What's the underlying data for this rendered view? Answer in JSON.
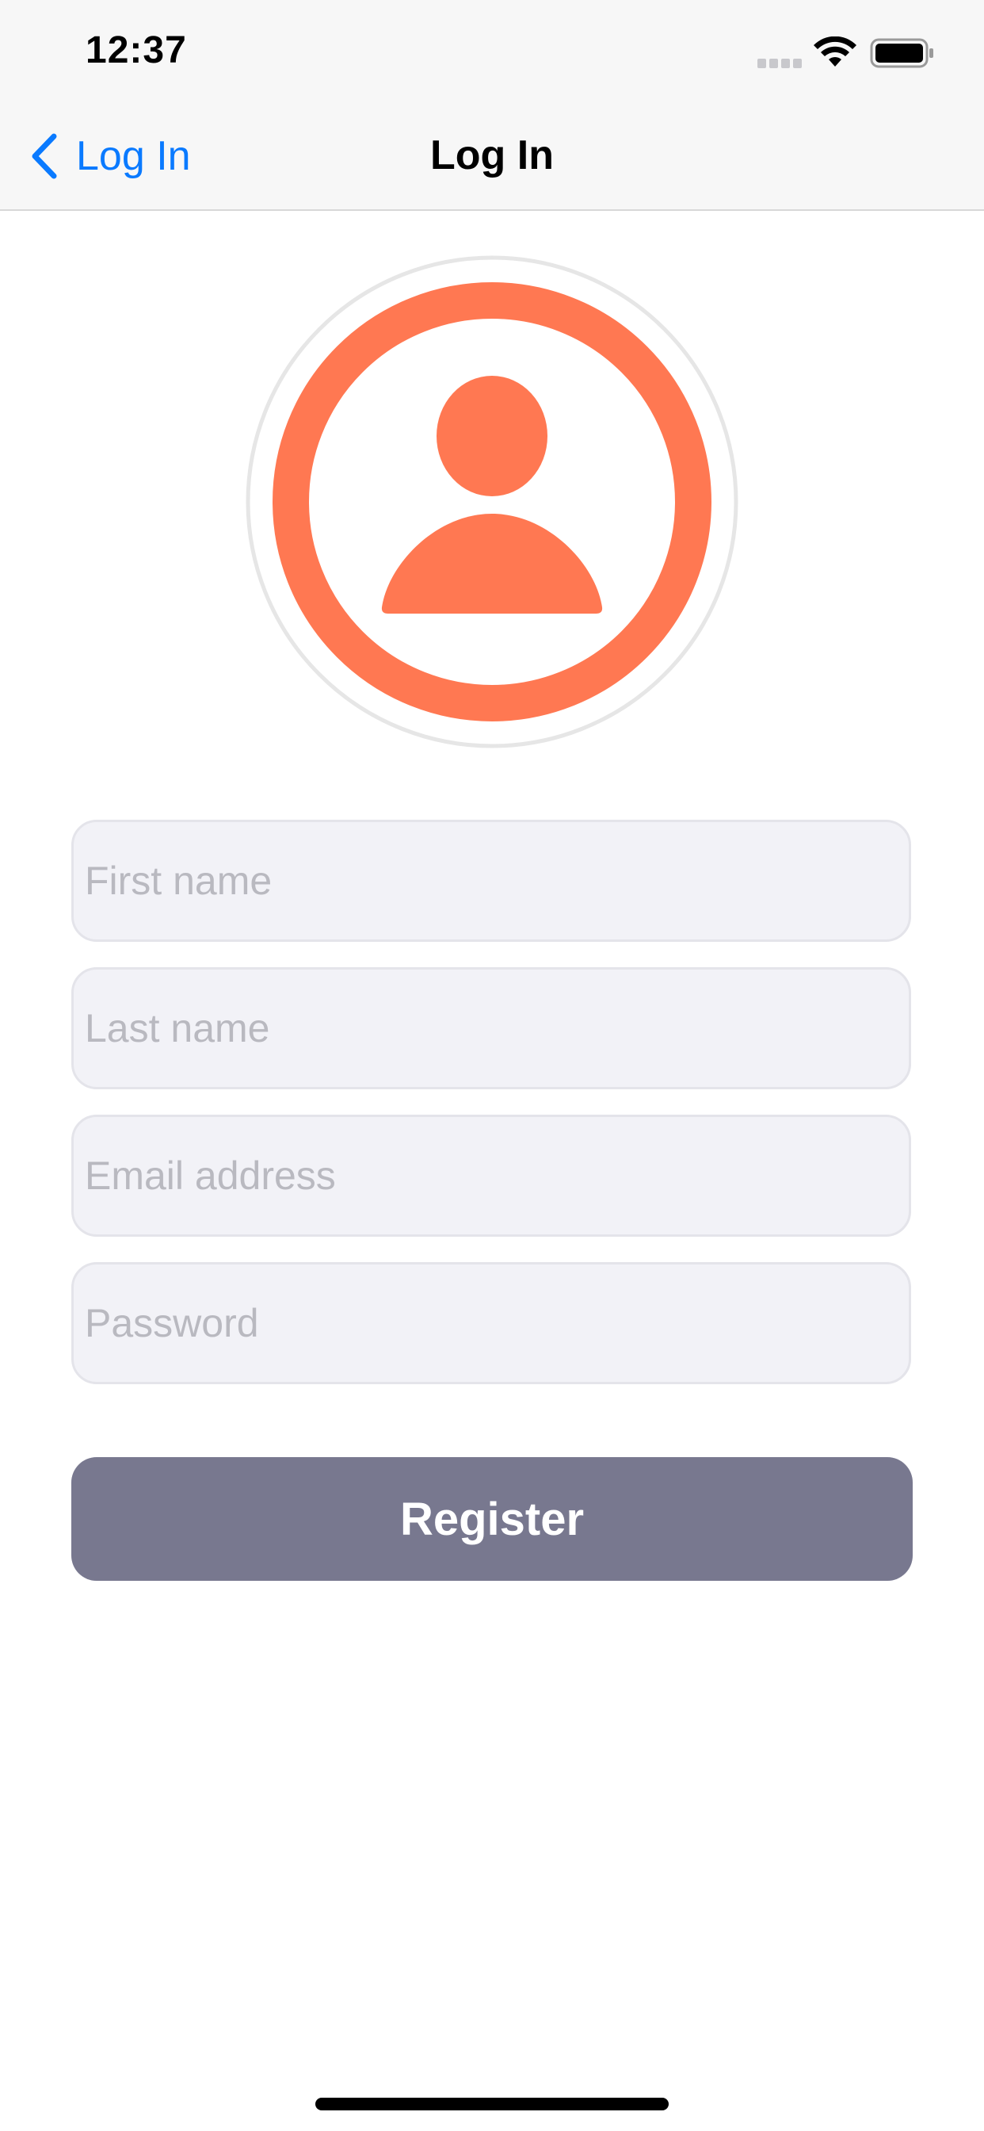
{
  "status_bar": {
    "time": "12:37",
    "icons": [
      "signal-dots-icon",
      "wifi-icon",
      "battery-icon"
    ]
  },
  "nav": {
    "back_label": "Log In",
    "title": "Log In",
    "back_icon": "chevron-left-icon"
  },
  "avatar": {
    "icon": "person-icon"
  },
  "form": {
    "first_name_placeholder": "First name",
    "last_name_placeholder": "Last name",
    "email_placeholder": "Email address",
    "password_placeholder": "Password",
    "first_name_value": "",
    "last_name_value": "",
    "email_value": "",
    "password_value": "",
    "register_label": "Register"
  },
  "colors": {
    "accent": "#0a7aff",
    "avatar": "#ff7852",
    "button": "#78788f",
    "field_bg": "#f2f2f7"
  }
}
